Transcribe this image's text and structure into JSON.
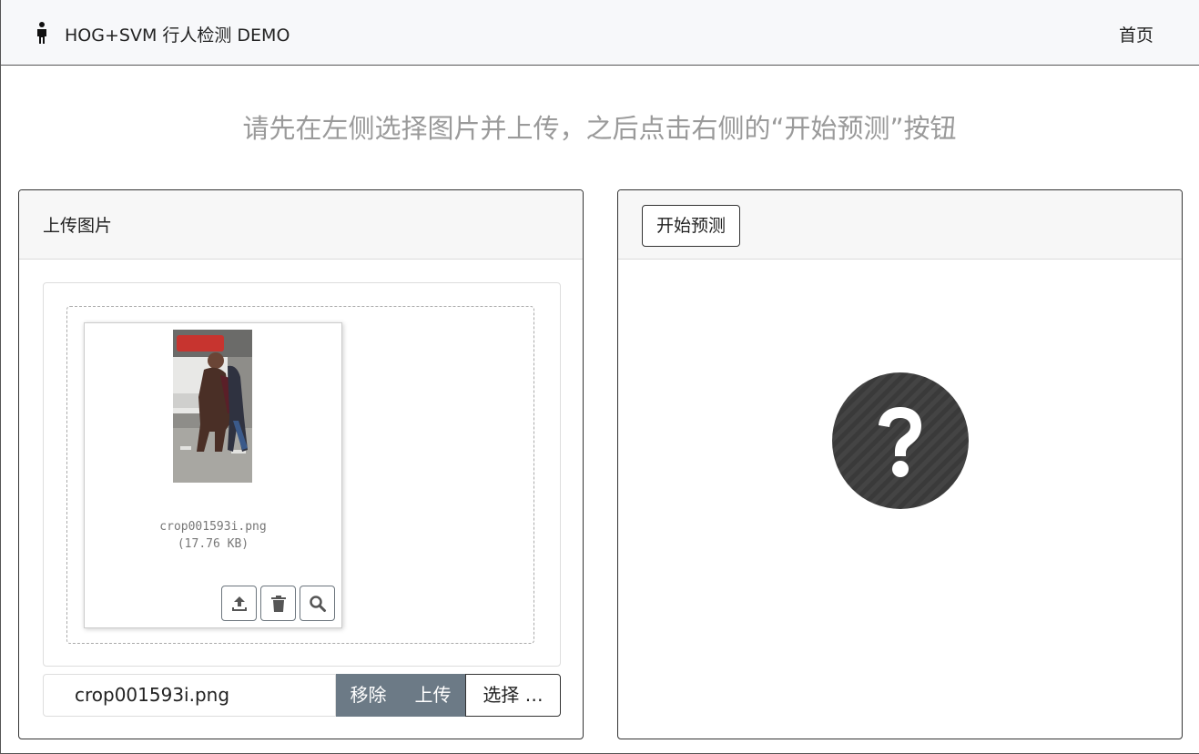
{
  "navbar": {
    "title": "HOG+SVM 行人检测 DEMO",
    "home_label": "首页",
    "brand_icon": "person-icon"
  },
  "instruction": "请先在左侧选择图片并上传，之后点击右侧的“开始预测”按钮",
  "upload_card": {
    "title": "上传图片",
    "preview": {
      "file_name": "crop001593i.png",
      "file_size": "(17.76 KB)",
      "actions": [
        "upload-icon",
        "trash-icon",
        "zoom-icon"
      ]
    },
    "caption_value": "crop001593i.png",
    "remove_label": "移除",
    "upload_label": "上传",
    "browse_label": "选择 …"
  },
  "predict_card": {
    "button_label": "开始预测",
    "result_icon": "question-icon"
  },
  "colors": {
    "secondary_button": "#6c7a86",
    "result_circle": "#3a3a3a",
    "lead_text": "#9a9a9a"
  }
}
